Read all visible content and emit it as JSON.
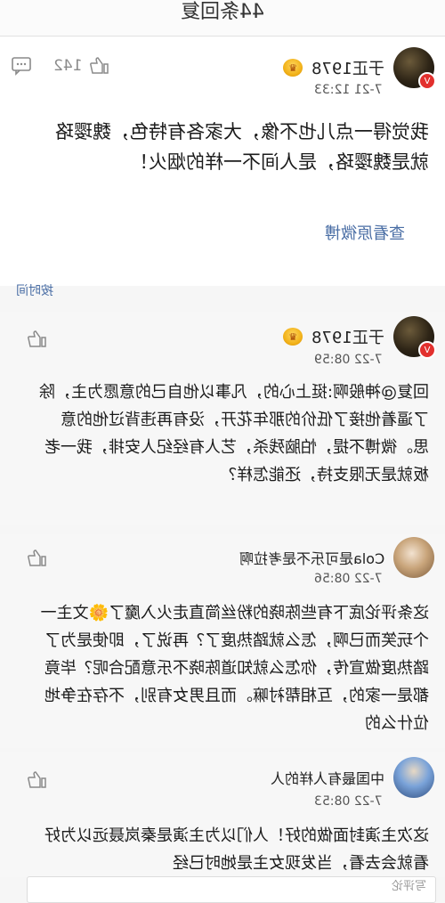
{
  "header": {
    "title": "44条回复"
  },
  "main_comment": {
    "username": "于正1978",
    "time": "7-21 12:33",
    "like_count": "142",
    "content": "我觉得一点儿也不像，大家各有特色，魏璎珞就是魏璎珞，是人间不一样的烟火！",
    "view_original": "查看原微博"
  },
  "sort_label": "按时间",
  "replies": [
    {
      "username": "于正1978",
      "time": "7-22 08:59",
      "content": "回复@神般啊:挺上心的，凡事以他自己的意愿为主，除了逼着他接了低价的那年花开，没有再违背过他的意思。微博不提，怕脑残杀，艺人有经纪人安排，我一老板就是无限支持，还能怎样？"
    },
    {
      "username": "Cola是可乐不是考拉啊",
      "time": "7-22 08:56",
      "content": "这条评论底下有些陈晓的粉丝简直走火入魔了🌼文主一个玩笑而已啊，怎么就踏热度了？再说了，即使是为了踏热度做宣传，你怎么就知道陈晓不乐意配合呢？毕竟都是一家的，互相帮衬嘛。而且男女有别，不存在争地位什么的"
    },
    {
      "username": "中国最有人样的人",
      "time": "7-22 08:53",
      "content": "这次主演封面做的好！人们以为主演是秦岚聂远以为好看就会去看，当发现女主是她时已经"
    }
  ],
  "input": {
    "placeholder": "写评论"
  }
}
